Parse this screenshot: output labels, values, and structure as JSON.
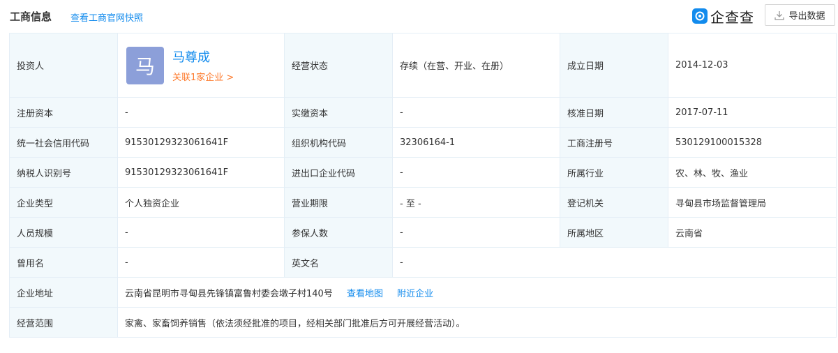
{
  "header": {
    "title": "工商信息",
    "snapshot_link": "查看工商官网快照",
    "brand_name": "企查查",
    "brand_icon": "qichacha-logo-icon",
    "export_label": "导出数据"
  },
  "investor": {
    "label": "投资人",
    "avatar_char": "马",
    "name": "马尊成",
    "related": "关联1家企业 >"
  },
  "rows": [
    {
      "l1": "经营状态",
      "v1": "存续（在营、开业、在册）",
      "l2": "成立日期",
      "v2": "2014-12-03"
    },
    {
      "l0": "注册资本",
      "v0": "-",
      "l1": "实缴资本",
      "v1": "-",
      "l2": "核准日期",
      "v2": "2017-07-11"
    },
    {
      "l0": "统一社会信用代码",
      "v0": "91530129323061641F",
      "l1": "组织机构代码",
      "v1": "32306164-1",
      "l2": "工商注册号",
      "v2": "530129100015328"
    },
    {
      "l0": "纳税人识别号",
      "v0": "91530129323061641F",
      "l1": "进出口企业代码",
      "v1": "-",
      "l2": "所属行业",
      "v2": "农、林、牧、渔业"
    },
    {
      "l0": "企业类型",
      "v0": "个人独资企业",
      "l1": "营业期限",
      "v1": "- 至 -",
      "l2": "登记机关",
      "v2": "寻甸县市场监督管理局"
    },
    {
      "l0": "人员规模",
      "v0": "-",
      "l1": "参保人数",
      "v1": "-",
      "l2": "所属地区",
      "v2": "云南省"
    },
    {
      "l0": "曾用名",
      "v0": "-",
      "l1": "英文名",
      "v1": "-"
    }
  ],
  "address": {
    "label": "企业地址",
    "value": "云南省昆明市寻甸县先锋镇富鲁村委会墩子村140号",
    "map_link": "查看地图",
    "nearby_link": "附近企业"
  },
  "scope": {
    "label": "经营范围",
    "value": "家禽、家畜饲养销售（依法须经批准的项目，经相关部门批准后方可开展经营活动）。"
  },
  "colors": {
    "accent": "#128bed",
    "orange": "#fd7a2c",
    "label_bg": "#f2f9fc",
    "avatar_bg": "#8c9fd9"
  }
}
